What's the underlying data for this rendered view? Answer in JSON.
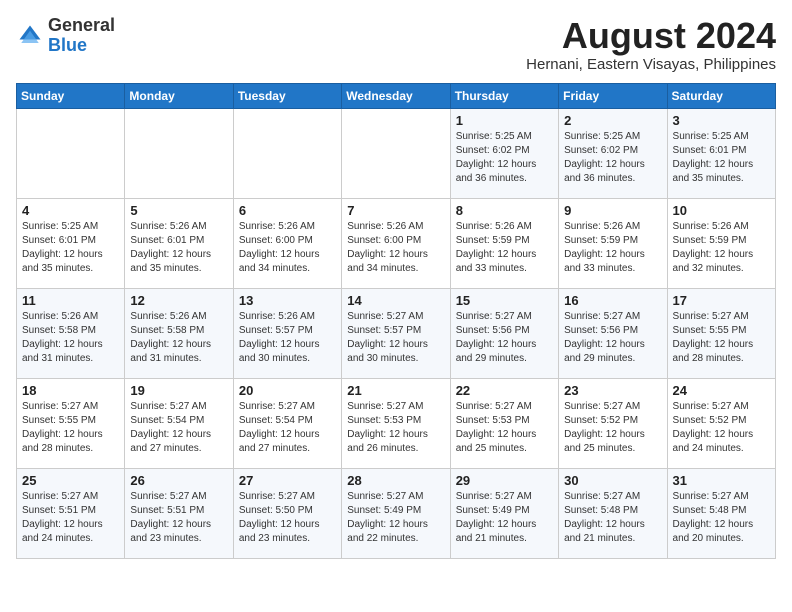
{
  "header": {
    "logo_general": "General",
    "logo_blue": "Blue",
    "month_year": "August 2024",
    "location": "Hernani, Eastern Visayas, Philippines"
  },
  "days_of_week": [
    "Sunday",
    "Monday",
    "Tuesday",
    "Wednesday",
    "Thursday",
    "Friday",
    "Saturday"
  ],
  "weeks": [
    [
      {
        "day": "",
        "info": ""
      },
      {
        "day": "",
        "info": ""
      },
      {
        "day": "",
        "info": ""
      },
      {
        "day": "",
        "info": ""
      },
      {
        "day": "1",
        "info": "Sunrise: 5:25 AM\nSunset: 6:02 PM\nDaylight: 12 hours\nand 36 minutes."
      },
      {
        "day": "2",
        "info": "Sunrise: 5:25 AM\nSunset: 6:02 PM\nDaylight: 12 hours\nand 36 minutes."
      },
      {
        "day": "3",
        "info": "Sunrise: 5:25 AM\nSunset: 6:01 PM\nDaylight: 12 hours\nand 35 minutes."
      }
    ],
    [
      {
        "day": "4",
        "info": "Sunrise: 5:25 AM\nSunset: 6:01 PM\nDaylight: 12 hours\nand 35 minutes."
      },
      {
        "day": "5",
        "info": "Sunrise: 5:26 AM\nSunset: 6:01 PM\nDaylight: 12 hours\nand 35 minutes."
      },
      {
        "day": "6",
        "info": "Sunrise: 5:26 AM\nSunset: 6:00 PM\nDaylight: 12 hours\nand 34 minutes."
      },
      {
        "day": "7",
        "info": "Sunrise: 5:26 AM\nSunset: 6:00 PM\nDaylight: 12 hours\nand 34 minutes."
      },
      {
        "day": "8",
        "info": "Sunrise: 5:26 AM\nSunset: 5:59 PM\nDaylight: 12 hours\nand 33 minutes."
      },
      {
        "day": "9",
        "info": "Sunrise: 5:26 AM\nSunset: 5:59 PM\nDaylight: 12 hours\nand 33 minutes."
      },
      {
        "day": "10",
        "info": "Sunrise: 5:26 AM\nSunset: 5:59 PM\nDaylight: 12 hours\nand 32 minutes."
      }
    ],
    [
      {
        "day": "11",
        "info": "Sunrise: 5:26 AM\nSunset: 5:58 PM\nDaylight: 12 hours\nand 31 minutes."
      },
      {
        "day": "12",
        "info": "Sunrise: 5:26 AM\nSunset: 5:58 PM\nDaylight: 12 hours\nand 31 minutes."
      },
      {
        "day": "13",
        "info": "Sunrise: 5:26 AM\nSunset: 5:57 PM\nDaylight: 12 hours\nand 30 minutes."
      },
      {
        "day": "14",
        "info": "Sunrise: 5:27 AM\nSunset: 5:57 PM\nDaylight: 12 hours\nand 30 minutes."
      },
      {
        "day": "15",
        "info": "Sunrise: 5:27 AM\nSunset: 5:56 PM\nDaylight: 12 hours\nand 29 minutes."
      },
      {
        "day": "16",
        "info": "Sunrise: 5:27 AM\nSunset: 5:56 PM\nDaylight: 12 hours\nand 29 minutes."
      },
      {
        "day": "17",
        "info": "Sunrise: 5:27 AM\nSunset: 5:55 PM\nDaylight: 12 hours\nand 28 minutes."
      }
    ],
    [
      {
        "day": "18",
        "info": "Sunrise: 5:27 AM\nSunset: 5:55 PM\nDaylight: 12 hours\nand 28 minutes."
      },
      {
        "day": "19",
        "info": "Sunrise: 5:27 AM\nSunset: 5:54 PM\nDaylight: 12 hours\nand 27 minutes."
      },
      {
        "day": "20",
        "info": "Sunrise: 5:27 AM\nSunset: 5:54 PM\nDaylight: 12 hours\nand 27 minutes."
      },
      {
        "day": "21",
        "info": "Sunrise: 5:27 AM\nSunset: 5:53 PM\nDaylight: 12 hours\nand 26 minutes."
      },
      {
        "day": "22",
        "info": "Sunrise: 5:27 AM\nSunset: 5:53 PM\nDaylight: 12 hours\nand 25 minutes."
      },
      {
        "day": "23",
        "info": "Sunrise: 5:27 AM\nSunset: 5:52 PM\nDaylight: 12 hours\nand 25 minutes."
      },
      {
        "day": "24",
        "info": "Sunrise: 5:27 AM\nSunset: 5:52 PM\nDaylight: 12 hours\nand 24 minutes."
      }
    ],
    [
      {
        "day": "25",
        "info": "Sunrise: 5:27 AM\nSunset: 5:51 PM\nDaylight: 12 hours\nand 24 minutes."
      },
      {
        "day": "26",
        "info": "Sunrise: 5:27 AM\nSunset: 5:51 PM\nDaylight: 12 hours\nand 23 minutes."
      },
      {
        "day": "27",
        "info": "Sunrise: 5:27 AM\nSunset: 5:50 PM\nDaylight: 12 hours\nand 23 minutes."
      },
      {
        "day": "28",
        "info": "Sunrise: 5:27 AM\nSunset: 5:49 PM\nDaylight: 12 hours\nand 22 minutes."
      },
      {
        "day": "29",
        "info": "Sunrise: 5:27 AM\nSunset: 5:49 PM\nDaylight: 12 hours\nand 21 minutes."
      },
      {
        "day": "30",
        "info": "Sunrise: 5:27 AM\nSunset: 5:48 PM\nDaylight: 12 hours\nand 21 minutes."
      },
      {
        "day": "31",
        "info": "Sunrise: 5:27 AM\nSunset: 5:48 PM\nDaylight: 12 hours\nand 20 minutes."
      }
    ]
  ]
}
